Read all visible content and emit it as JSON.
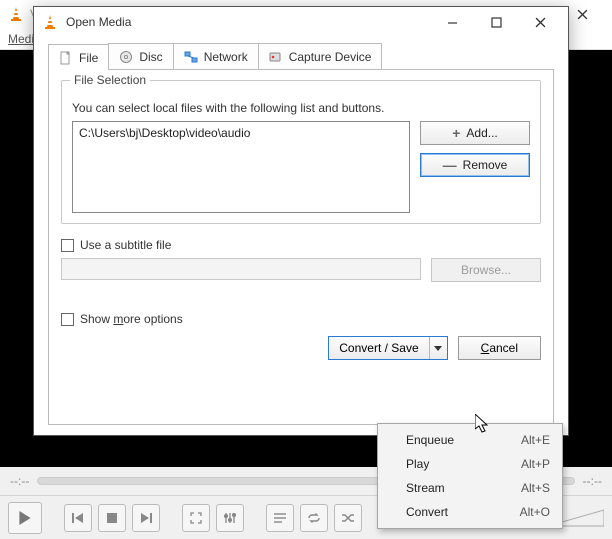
{
  "main": {
    "title_initial": "V",
    "menu_media": "Medi"
  },
  "seek": {
    "left_time": "--:--",
    "right_time": "--:--"
  },
  "dialog": {
    "title": "Open Media",
    "tabs": {
      "file": "File",
      "disc": "Disc",
      "network": "Network",
      "capture": "Capture Device"
    },
    "group_title": "File Selection",
    "help_text": "You can select local files with the following list and buttons.",
    "file_path": "C:\\Users\\bj\\Desktop\\video\\audio",
    "add_label": "Add...",
    "remove_label": "Remove",
    "subtitle_chk": "Use a subtitle file",
    "browse_label": "Browse...",
    "more_prefix": "Show ",
    "more_underlined": "m",
    "more_suffix": "ore options",
    "convert_label": "Convert / Save",
    "cancel_prefix": "C",
    "cancel_suffix": "ancel"
  },
  "dropdown": [
    {
      "label": "Enqueue",
      "shortcut": "Alt+E"
    },
    {
      "label": "Play",
      "shortcut": "Alt+P"
    },
    {
      "label": "Stream",
      "shortcut": "Alt+S"
    },
    {
      "label": "Convert",
      "shortcut": "Alt+O"
    }
  ],
  "volume_pct": "%"
}
